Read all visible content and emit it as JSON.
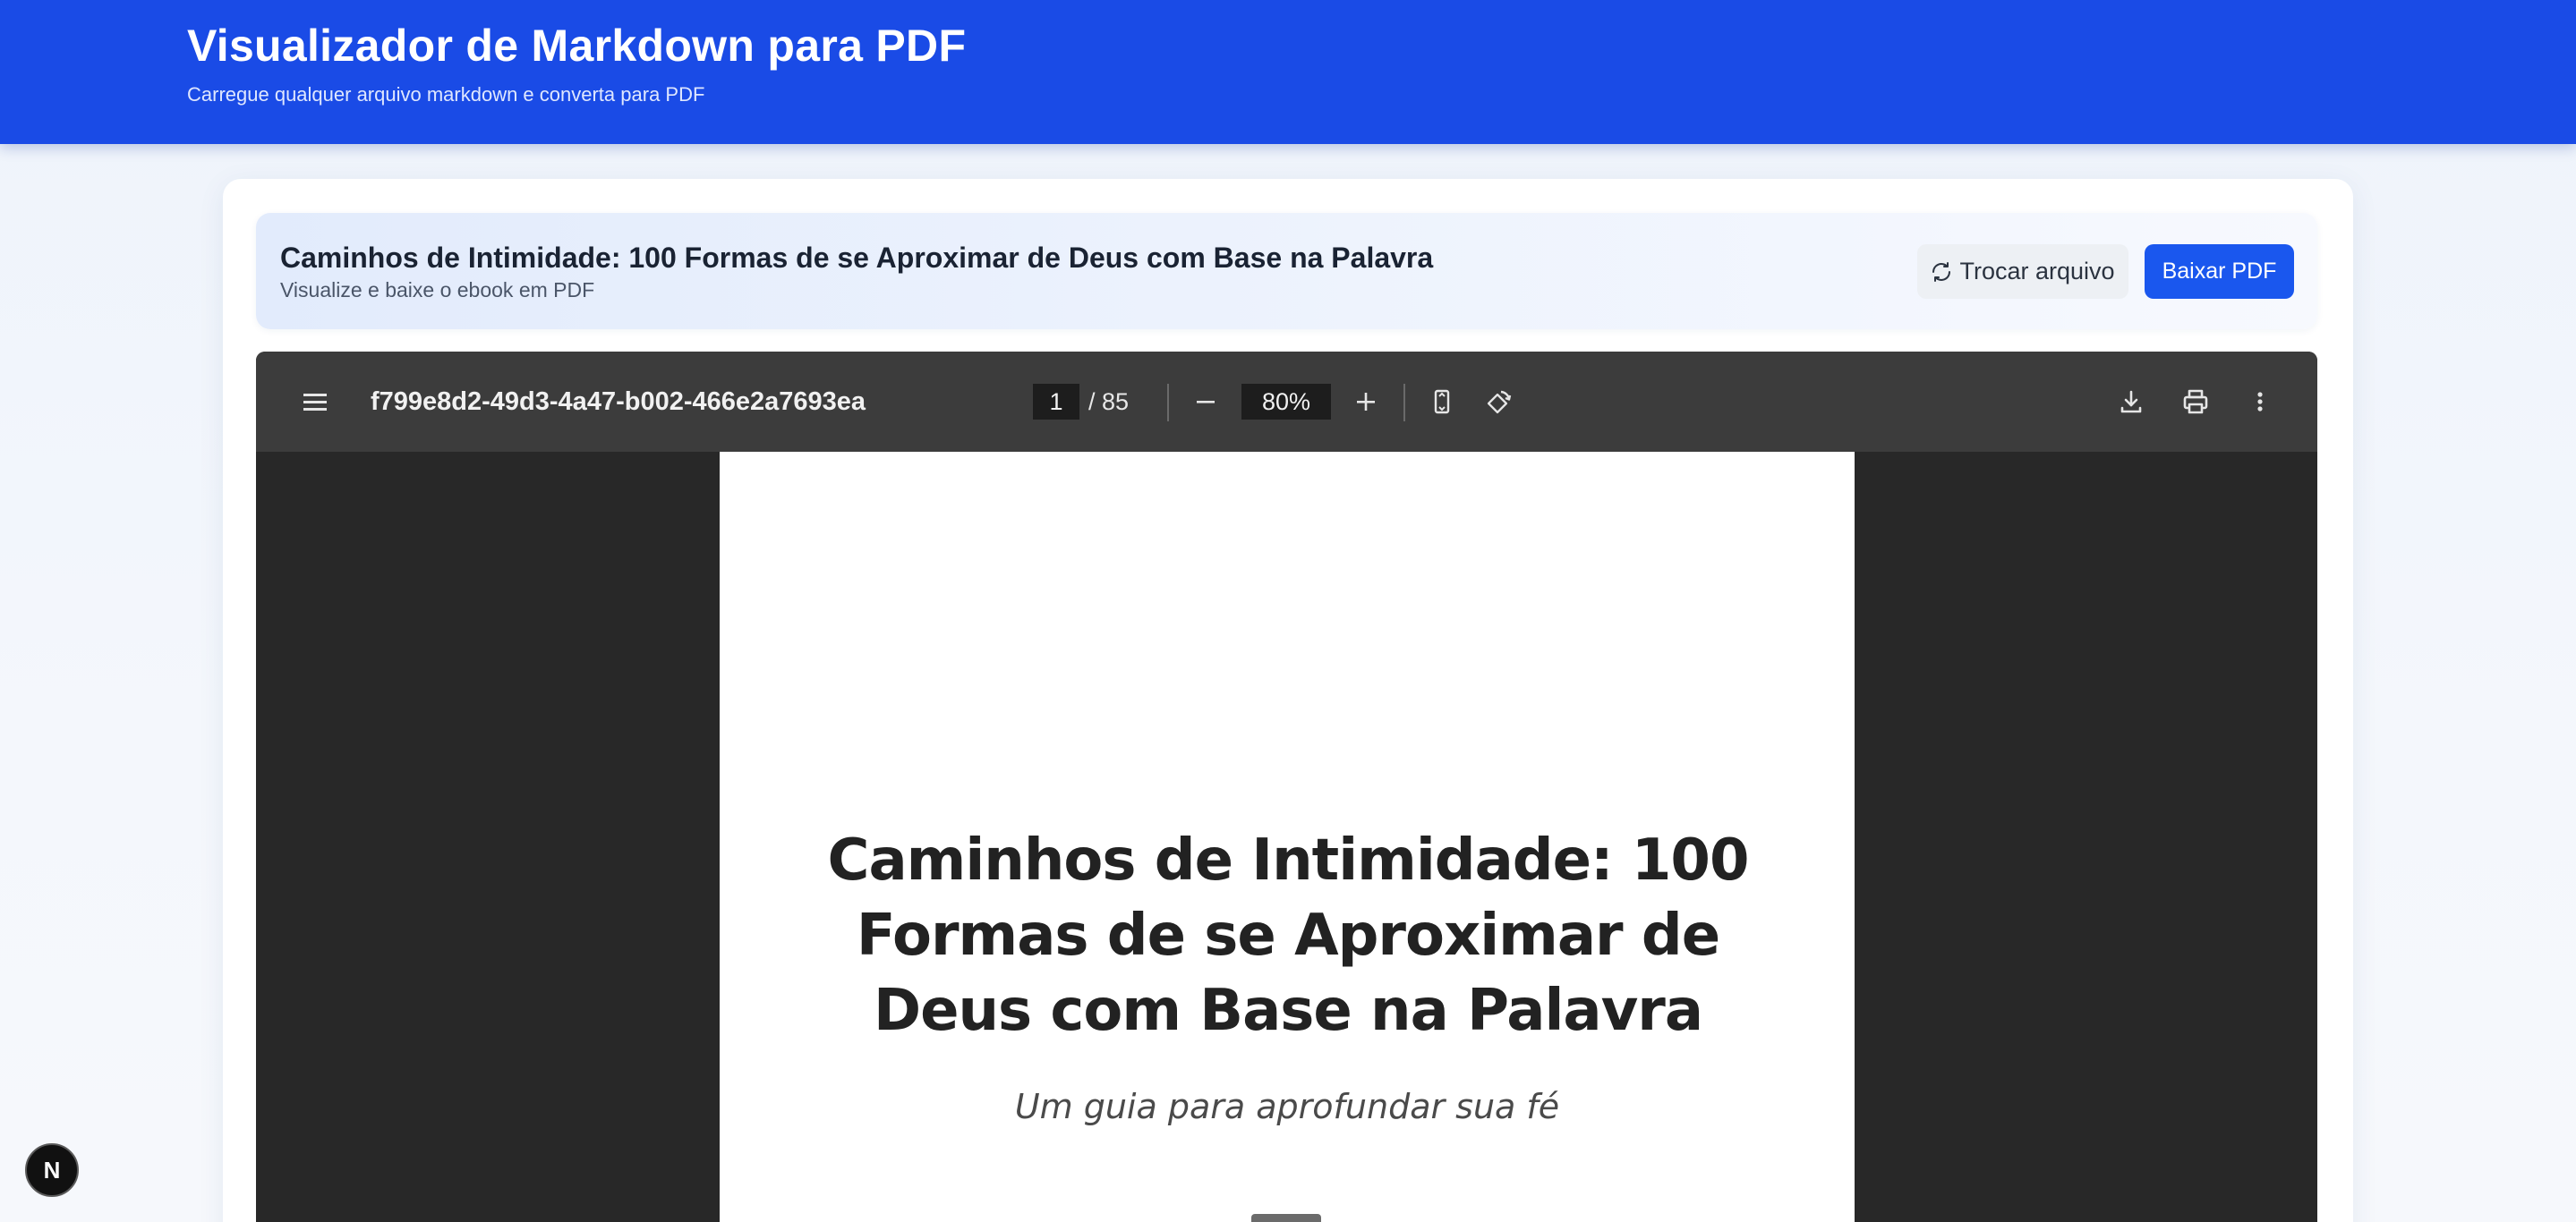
{
  "header": {
    "title": "Visualizador de Markdown para PDF",
    "subtitle": "Carregue qualquer arquivo markdown e converta para PDF",
    "background_color": "#1a4be6"
  },
  "doc_bar": {
    "title": "Caminhos de Intimidade: 100 Formas de se Aproximar de Deus com Base na Palavra",
    "subtitle": "Visualize e baixe o ebook em PDF",
    "swap_button_label": "Trocar arquivo",
    "swap_button_icon": "refresh-icon",
    "download_button_label": "Baixar PDF",
    "accent_color": "#1a57ee"
  },
  "pdf_viewer": {
    "toolbar": {
      "menu_icon": "hamburger-menu-icon",
      "filename": "f799e8d2-49d3-4a47-b002-466e2a7693ea",
      "current_page": "1",
      "total_pages": "/ 85",
      "zoom": "80%",
      "icons": [
        "zoom-out-icon",
        "zoom-in-icon",
        "fit-page-icon",
        "rotate-icon",
        "download-icon",
        "print-icon",
        "more-vertical-icon"
      ]
    },
    "page": {
      "title": "Caminhos de Intimidade: 100 Formas de se Aproximar de Deus com Base na Palavra",
      "subtitle": "Um guia para aprofundar sua fé"
    }
  },
  "badge": {
    "label": "N"
  }
}
